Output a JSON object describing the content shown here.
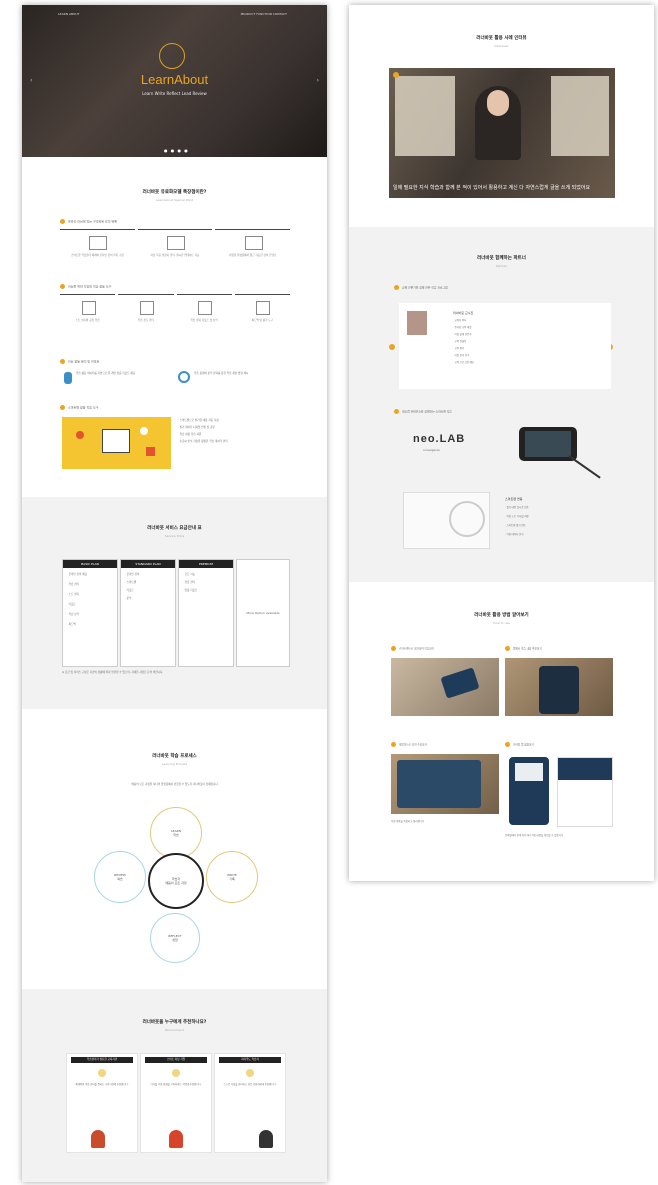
{
  "hero": {
    "nav_left": "LEARN ABOUT",
    "nav_right": "PRODUCT  FUNCTION  CONTACT",
    "brand": "LearnAbout",
    "tagline": "Learn Write Reflect Lead Review",
    "dots": "● ● ● ●"
  },
  "intro": {
    "title": "러너바웃 유료화모델 특장점이란?",
    "subtitle": "LearnAbout Special Point",
    "group1": "온라인 러닝에 있는 구조화된 강의 목록",
    "cards1": [
      "스마트한 학습관리 체계와 온라인 강의 목록 구성",
      "러닝 목표 설정과 관리, 실시간 업데이트 기능",
      "다양한 플랫폼에서 접근 가능한 강의 콘텐츠"
    ],
    "group2": "러닝을 위한 다양한 학습 활동 도구",
    "cards2": [
      "노트 필기와 공유 학습",
      "학습 진도 관리",
      "학습 결과 리포트 및 분석",
      "피드백 및 평가 도구"
    ],
    "group3": "러닝 활동 분석 및 리포트",
    "g3_left": "학습 활동 데이터를 기반으로 한 개인 맞춤 리포트 제공",
    "g3_right": "학습 통계와 분석 결과를 통한 학습 개선 방향 제시",
    "group4": "스마트펜 활용 학습 도구",
    "g4_lines": [
      "· 스마트펜으로 필기한 내용 자동 저장",
      "· 필기 데이터 디지털 변환 및 공유",
      "· 학습 내용 복습 지원",
      "· 손글씨 인식 기술을 활용한 학습 데이터 관리"
    ]
  },
  "plans": {
    "title": "러너바웃 서비스 요금안내 표",
    "subtitle": "Service Price",
    "cols": [
      {
        "head": "BASIC PLAN",
        "lines": [
          "· 온라인 강의 제공",
          "· 학습 관리",
          "· 노트 필기",
          "· 리포트",
          "· 학습 분석",
          "· 피드백"
        ]
      },
      {
        "head": "STANDARD PLAN",
        "lines": [
          "· 온라인 강의",
          "· 스마트펜",
          "· 리포트",
          "· 분석"
        ]
      },
      {
        "head": "PREMIUM",
        "lines": [
          "· 모든 기능",
          "· 전담 관리",
          "· 맞춤 리포트"
        ]
      }
    ],
    "extra": "More Option Available",
    "note": "※ 요금 및 서비스 구성은 기관의 상황에 따라 변경될 수 있으며, 자세한 사항은 문의 바랍니다."
  },
  "cycle": {
    "title": "러너바웃 학습 프로세스",
    "subtitle": "Learning Process",
    "intro": "배움의 모든 과정을 하나의 플랫폼에서 경험할 수 있도록 러너바웃이 함께합니다.",
    "center": "학습자\n배움의 모든 과정",
    "top": "LEARN\n학습",
    "right": "WRITE\n기록",
    "bottom": "REFLECT\n성찰",
    "left": "REVIEW\n복습"
  },
  "personas": {
    "title": "러너바웃을 누구에게 추천하나요?",
    "subtitle": "Recommend",
    "items": [
      {
        "head": "학습관리가 필요한 교육기관",
        "text": "체계적인 학습 관리를 원하는 교육기관에 추천합니다."
      },
      {
        "head": "스마트 러닝 기업",
        "text": "디지털 학습 환경을 구축하려는 기업에 추천합니다."
      },
      {
        "head": "자기주도 학습자",
        "text": "스스로 학습을 관리하고 싶은 학습자에게 추천합니다."
      }
    ]
  },
  "right": {
    "video_title": "러너바웃 활용 사례 인터뷰",
    "video_sub": "Interview",
    "caption": "일에 필요한 지식 학습과 함께 본 적이 있어서 활용하고 계신 다 자연스럽게 글을 쓰게 되었어요",
    "partner_title": "러너바웃 함께하는 파트너",
    "partner_sub": "Partner",
    "p1_title": "교육 전문가와 함께 만든 학습 프로그램",
    "profile_name": "러너바웃 교수진",
    "profile_lines": [
      "· 교육학 박사",
      "· 온라인 교육 개발",
      "· 학습 설계 전문가",
      "· 교육 컨설팅",
      "· 교육 평가",
      "· 학습 분석 연구",
      "· 교육 프로그램 개발"
    ],
    "p2_title": "네오랩 컨버전스와 함께하는 스마트펜 학습",
    "neolab": "neo.LAB",
    "neolab_sub": "convergence",
    "pen_title": "스마트펜 연동",
    "pen_lines": [
      "· 필기 내용 실시간 전송",
      "· 학습 노트 디지털 저장",
      "· 스마트펜 필기 연동",
      "· 학습 데이터 분석"
    ],
    "use_title": "러너바웃 활용 방법 알아보기",
    "use_sub": "How to use",
    "uses": [
      {
        "label": "스마트펜으로 필기하며 학습하기"
      },
      {
        "label": "앱에서 학습 내용 확인하기"
      },
      {
        "label": "태블릿으로 강의 수강하기"
      },
      {
        "label": "모바일 앱 활용하기"
      }
    ],
    "use_caption1": "학습 내용을 복습하고 정리합니다",
    "use_caption2": "모바일에서 언제 어디서나 학습 내용을 확인할 수 있습니다"
  }
}
